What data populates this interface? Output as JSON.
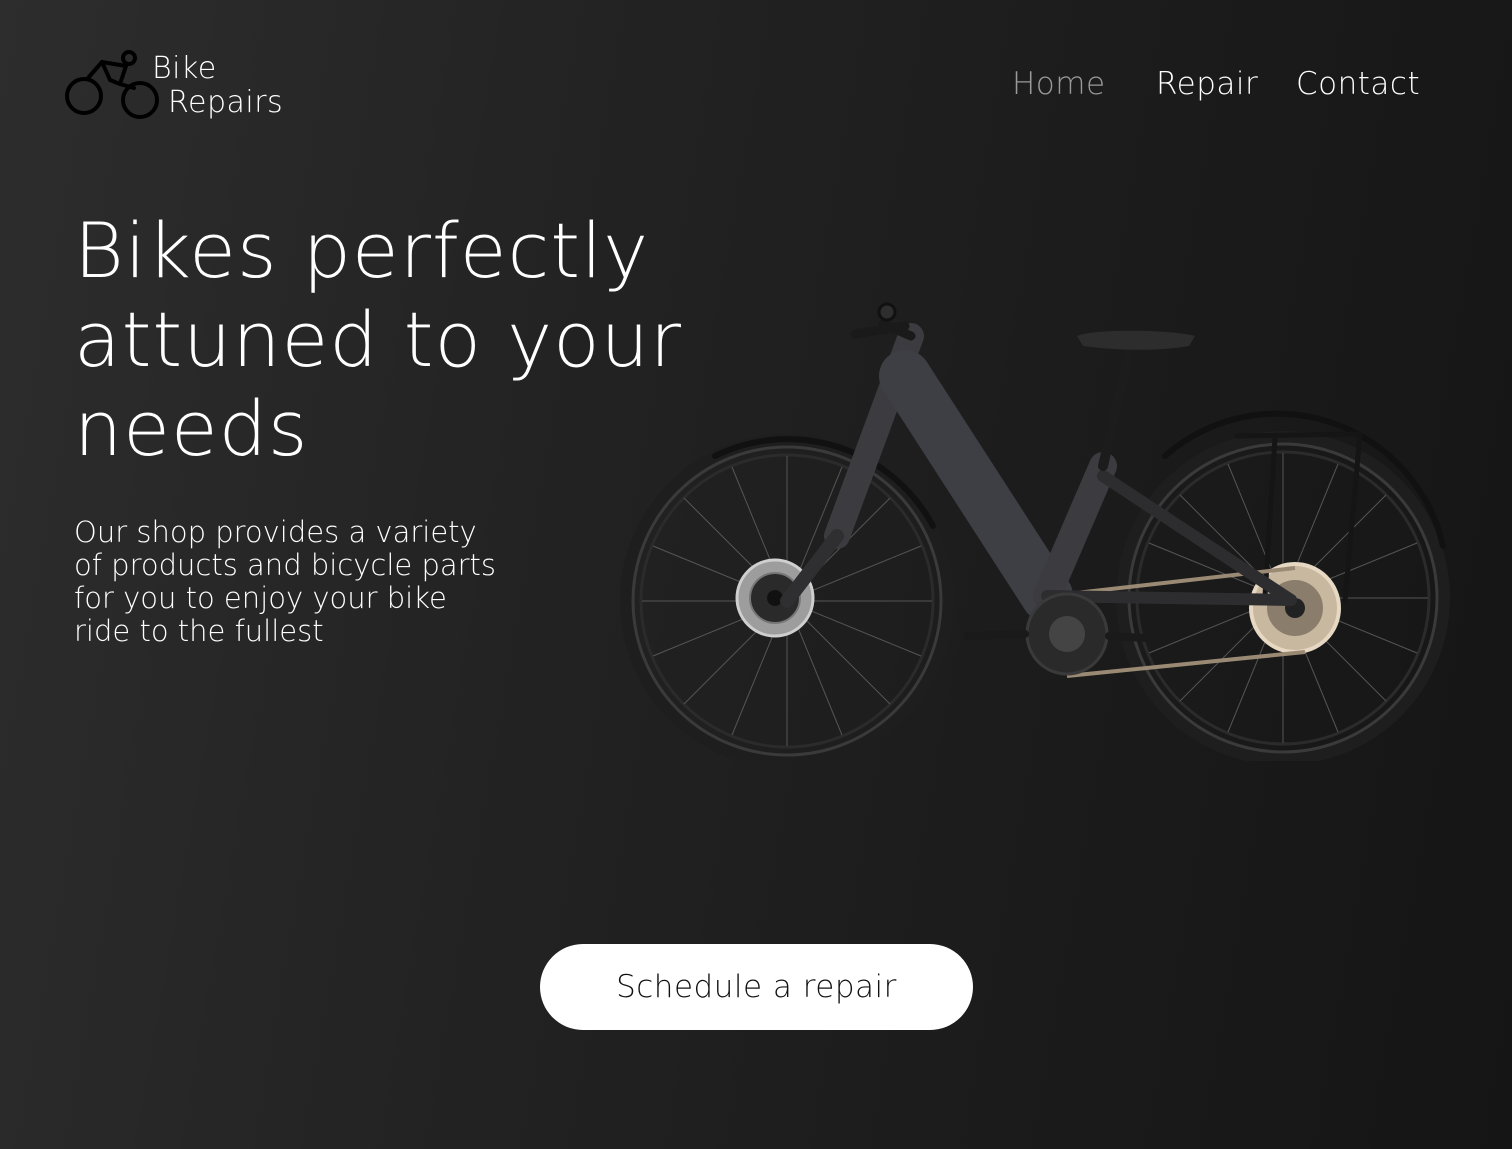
{
  "brand": {
    "line1": "Bike",
    "line2": "Repairs",
    "icon": "cyclist-icon"
  },
  "nav": {
    "items": [
      {
        "label": "Home",
        "active": true
      },
      {
        "label": "Repair",
        "active": false
      },
      {
        "label": "Contact",
        "active": false
      }
    ]
  },
  "hero": {
    "title": "Bikes perfectly attuned to your needs",
    "description": "Our shop provides a variety of products and bicycle parts for you to enjoy your bike ride to the fullest",
    "image": "bicycle-image"
  },
  "cta": {
    "label": "Schedule a repair"
  },
  "colors": {
    "background": "#262626",
    "text": "#ffffff",
    "nav_active": "#9a9a9a",
    "button_bg": "#ffffff",
    "button_text": "#111111"
  }
}
